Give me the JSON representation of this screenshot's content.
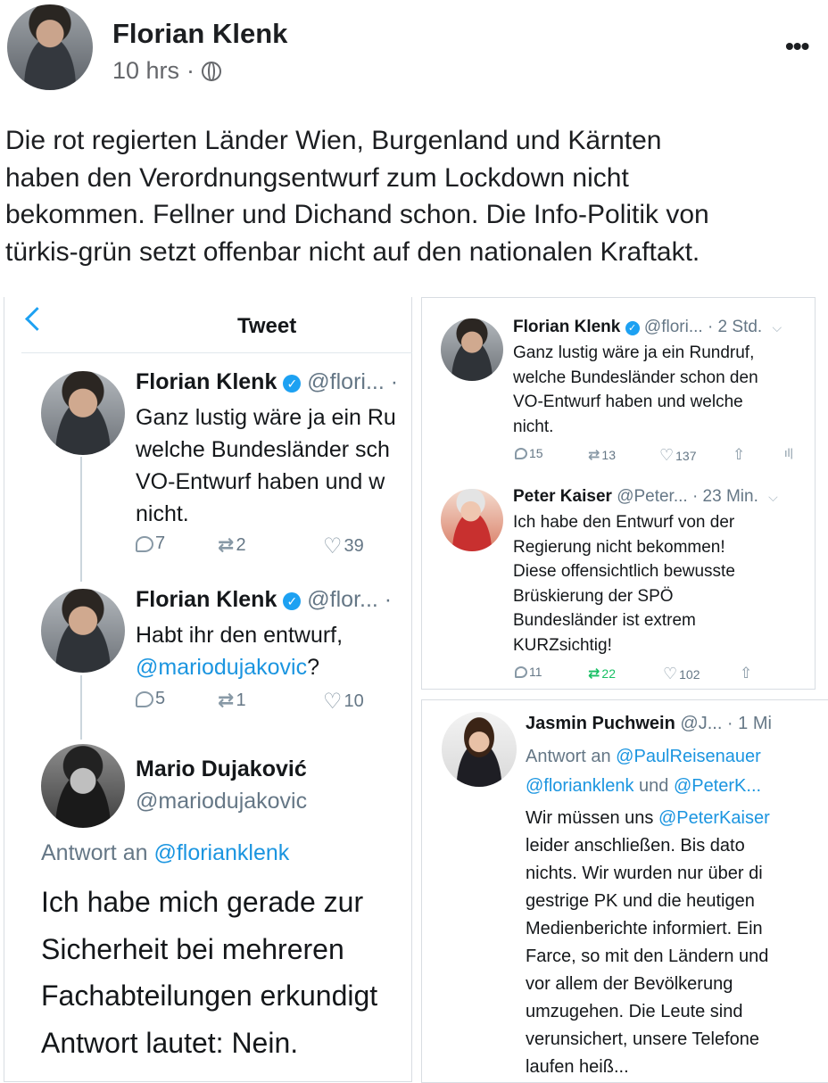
{
  "post": {
    "author": "Florian Klenk",
    "time": "10 hrs",
    "dot": "·",
    "more": "•••",
    "text_lines": [
      "Die rot regierten Länder Wien, Burgenland und Kärnten",
      "haben den Verordnungsentwurf zum Lockdown nicht",
      "bekommen. Fellner und Dichand schon. Die Info-Politik von",
      "türkis-grün setzt offenbar nicht auf den nationalen Kraftakt."
    ]
  },
  "left_panel": {
    "header": "Tweet",
    "tweets": [
      {
        "name": "Florian Klenk",
        "handle": "@flori... ·",
        "lines": [
          "Ganz lustig wäre ja ein Ru",
          "welche Bundesländer sch",
          "VO-Entwurf haben und w",
          "nicht."
        ],
        "replies": "7",
        "retweets": "2",
        "likes": "39"
      },
      {
        "name": "Florian Klenk",
        "handle": "@flor... ·",
        "line1": "Habt ihr den entwurf,",
        "mention": "@mariodujakovic",
        "mention_suffix": "?",
        "replies": "5",
        "retweets": "1",
        "likes": "10"
      },
      {
        "name": "Mario Dujaković",
        "handle": "@mariodujakovic",
        "reply_label": "Antwort an ",
        "reply_mention": "@florianklenk",
        "lines": [
          "Ich habe mich gerade zur",
          "Sicherheit bei mehreren",
          "Fachabteilungen erkundigt",
          "Antwort lautet: Nein."
        ]
      }
    ]
  },
  "right_top_panel": {
    "tweets": [
      {
        "name": "Florian Klenk",
        "handle": "@flori... · 2 Std.",
        "lines": [
          "Ganz lustig wäre ja ein Rundruf,",
          "welche Bundesländer schon den",
          "VO-Entwurf haben und welche",
          "nicht."
        ],
        "replies": "15",
        "retweets": "13",
        "likes": "137"
      },
      {
        "name": "Peter Kaiser",
        "handle": "@Peter... · 23 Min.",
        "lines": [
          "Ich habe den Entwurf von der",
          "Regierung nicht bekommen!",
          "Diese offensichtlich bewusste",
          "Brüskierung der SPÖ",
          "Bundesländer ist extrem",
          "KURZsichtig!"
        ],
        "replies": "11",
        "retweets": "22",
        "likes": "102"
      }
    ]
  },
  "right_bottom_panel": {
    "name": "Jasmin Puchwein",
    "handle": "@J... · 1 Mi",
    "reply_label": "Antwort an ",
    "reply_mention1": "@PaulReisenauer",
    "reply_mention2": "@florianklenk",
    "reply_und": " und ",
    "reply_mention3": "@PeterK...",
    "line1_prefix": "Wir müssen uns ",
    "line1_mention": "@PeterKaiser",
    "lines": [
      "leider anschließen. Bis dato",
      "nichts. Wir wurden nur über di",
      "gestrige PK und die heutigen",
      "Medienberichte informiert. Ein",
      "Farce, so mit den Ländern und",
      "vor allem der Bevölkerung",
      "umzugehen. Die Leute sind",
      "verunsichert, unsere Telefone",
      "laufen heiß..."
    ]
  },
  "icons": {
    "retweet": "⇄",
    "like": "♡",
    "share": "⇧",
    "stats": "ıl|",
    "chevron": "⌵",
    "verified": "✓"
  },
  "colors": {
    "twitter_blue": "#1da1f2",
    "retweet_green": "#17bf63",
    "text_gray": "#657786"
  }
}
